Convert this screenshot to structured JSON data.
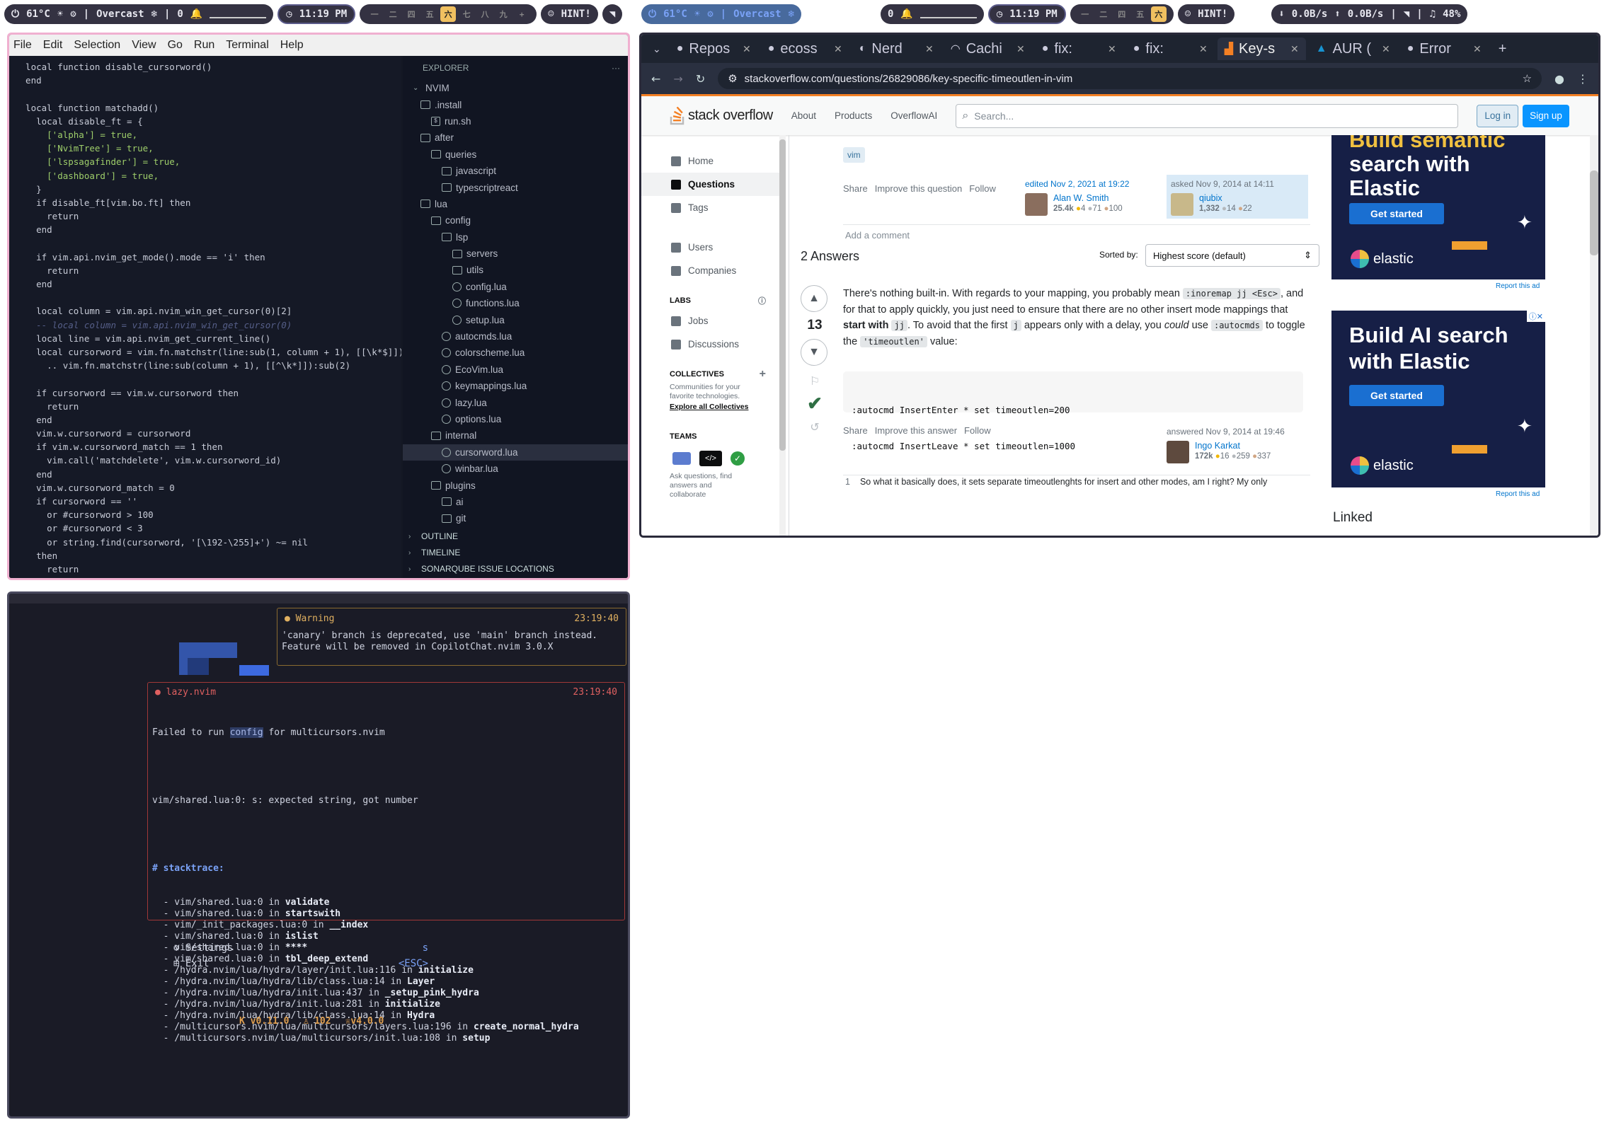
{
  "waybar_left": {
    "temp": "61°C",
    "weather": "Overcast",
    "notifications": "0",
    "clock": "11:19 PM",
    "hint": "HINT!"
  },
  "waybar_right": {
    "temp": "61°C",
    "weather": "Overcast",
    "notifications": "0",
    "clock": "11:19 PM",
    "hint": "HINT!",
    "net_down": "0.0B/s",
    "net_up": "0.0B/s",
    "battery": "48%"
  },
  "vscode": {
    "menu": [
      "File",
      "Edit",
      "Selection",
      "View",
      "Go",
      "Run",
      "Terminal",
      "Help"
    ],
    "explorer_title": "EXPLORER",
    "explorer_more": "···",
    "root": "NVIM",
    "tree": [
      {
        "label": ".install",
        "type": "folder",
        "depth": 1
      },
      {
        "label": "run.sh",
        "type": "shell",
        "depth": 2
      },
      {
        "label": "after",
        "type": "folder",
        "depth": 1
      },
      {
        "label": "queries",
        "type": "folder",
        "depth": 2
      },
      {
        "label": "javascript",
        "type": "folder",
        "depth": 3
      },
      {
        "label": "typescriptreact",
        "type": "folder",
        "depth": 3
      },
      {
        "label": "lua",
        "type": "folder",
        "depth": 1
      },
      {
        "label": "config",
        "type": "folder",
        "depth": 2
      },
      {
        "label": "lsp",
        "type": "folder",
        "depth": 3
      },
      {
        "label": "servers",
        "type": "folder",
        "depth": 4
      },
      {
        "label": "utils",
        "type": "folder",
        "depth": 4
      },
      {
        "label": "config.lua",
        "type": "lua",
        "depth": 4
      },
      {
        "label": "functions.lua",
        "type": "lua",
        "depth": 4
      },
      {
        "label": "setup.lua",
        "type": "lua",
        "depth": 4
      },
      {
        "label": "autocmds.lua",
        "type": "lua",
        "depth": 3
      },
      {
        "label": "colorscheme.lua",
        "type": "lua",
        "depth": 3
      },
      {
        "label": "EcoVim.lua",
        "type": "lua",
        "depth": 3
      },
      {
        "label": "keymappings.lua",
        "type": "lua",
        "depth": 3
      },
      {
        "label": "lazy.lua",
        "type": "lua",
        "depth": 3
      },
      {
        "label": "options.lua",
        "type": "lua",
        "depth": 3
      },
      {
        "label": "internal",
        "type": "folder",
        "depth": 2
      },
      {
        "label": "cursorword.lua",
        "type": "lua",
        "depth": 3,
        "selected": true
      },
      {
        "label": "winbar.lua",
        "type": "lua",
        "depth": 3
      },
      {
        "label": "plugins",
        "type": "folder",
        "depth": 2
      },
      {
        "label": "ai",
        "type": "folder",
        "depth": 3
      },
      {
        "label": "git",
        "type": "folder",
        "depth": 3
      }
    ],
    "sections": [
      "OUTLINE",
      "TIMELINE",
      "SONARQUBE ISSUE LOCATIONS"
    ]
  },
  "code_lines": [
    "  local function disable_cursorword()",
    "  end",
    "",
    "  local function matchadd()",
    "    local disable_ft = {",
    "      ['alpha'] = true,",
    "      ['NvimTree'] = true,",
    "      ['lspsagafinder'] = true,",
    "      ['dashboard'] = true,",
    "    }",
    "    if disable_ft[vim.bo.ft] then",
    "      return",
    "    end",
    "",
    "    if vim.api.nvim_get_mode().mode == 'i' then",
    "      return",
    "    end",
    "",
    "    local column = vim.api.nvim_win_get_cursor(0)[2]",
    "    -- local column = vim.api.nvim_win_get_cursor(0)",
    "    local line = vim.api.nvim_get_current_line()",
    "    local cursorword = vim.fn.matchstr(line:sub(1, column + 1), [[\\k*$]])",
    "      .. vim.fn.matchstr(line:sub(column + 1), [[^\\k*]]):sub(2)",
    "",
    "    if cursorword == vim.w.cursorword then",
    "      return",
    "    end",
    "    vim.w.cursorword = cursorword",
    "    if vim.w.cursorword_match == 1 then",
    "      vim.call('matchdelete', vim.w.cursorword_id)",
    "    end",
    "    vim.w.cursorword_match = 0",
    "    if cursorword == ''",
    "      or #cursorword > 100",
    "      or #cursorword < 3",
    "      or string.find(cursorword, '[\\192-\\255]+') ~= nil",
    "    then",
    "      return"
  ],
  "terminal": {
    "warning": {
      "title": "Warning",
      "time": "23:19:40",
      "lines": [
        "'canary' branch is deprecated, use 'main' branch instead.",
        "Feature will be removed in CopilotChat.nvim 3.0.X"
      ]
    },
    "error": {
      "title": "lazy.nvim",
      "time": "23:19:40",
      "line1_pre": "Failed to run ",
      "line1_hl": "config",
      "line1_post": " for multicursors.nvim",
      "line2": "vim/shared.lua:0: s: expected string, got number",
      "stack_title": "# stacktrace:",
      "stack": [
        {
          "loc": "  - vim/shared.lua:0 in ",
          "fn": "validate"
        },
        {
          "loc": "  - vim/shared.lua:0 in ",
          "fn": "startswith"
        },
        {
          "loc": "  - vim/_init_packages.lua:0 in ",
          "fn": "__index"
        },
        {
          "loc": "  - vim/shared.lua:0 in ",
          "fn": "islist"
        },
        {
          "loc": "  - vim/shared.lua:0 in ",
          "fn": "****"
        },
        {
          "loc": "  - vim/shared.lua:0 in ",
          "fn": "tbl_deep_extend"
        },
        {
          "loc": "  - /hydra.nvim/lua/hydra/layer/init.lua:116 in ",
          "fn": "initialize"
        },
        {
          "loc": "  - /hydra.nvim/lua/hydra/lib/class.lua:14 in ",
          "fn": "Layer"
        },
        {
          "loc": "  - /hydra.nvim/lua/hydra/init.lua:437 in ",
          "fn": "_setup_pink_hydra"
        },
        {
          "loc": "  - /hydra.nvim/lua/hydra/init.lua:281 in ",
          "fn": "initialize"
        },
        {
          "loc": "  - /hydra.nvim/lua/hydra/lib/class.lua:14 in ",
          "fn": "Hydra"
        },
        {
          "loc": "  - /multicursors.nvim/lua/multicursors/layers.lua:196 in ",
          "fn": "create_normal_hydra"
        },
        {
          "loc": "  - /multicursors.nvim/lua/multicursors/init.lua:108 in ",
          "fn": "setup"
        }
      ]
    },
    "menu": [
      {
        "label": "Settings",
        "key": "s",
        "icon": "⚙"
      },
      {
        "label": "Exit",
        "key": "<ESC>",
        "icon": "⊞"
      }
    ],
    "stats": {
      "version": "v0.11.0",
      "plugins": "102",
      "lazy_version": "v4.0.0"
    }
  },
  "browser": {
    "tabs": [
      {
        "label": "Repos",
        "icon": "github"
      },
      {
        "label": "ecoss",
        "icon": "github"
      },
      {
        "label": "Nerd",
        "icon": "nerd"
      },
      {
        "label": "Cachi",
        "icon": "cache"
      },
      {
        "label": "fix: ",
        "icon": "github"
      },
      {
        "label": "fix: ",
        "icon": "github"
      },
      {
        "label": "Key-s",
        "icon": "so",
        "active": true
      },
      {
        "label": "AUR (",
        "icon": "arch"
      },
      {
        "label": "Error",
        "icon": "github"
      }
    ],
    "url": "stackoverflow.com/questions/26829086/key-specific-timeoutlen-in-vim"
  },
  "so": {
    "logo": "stack overflow",
    "nav_links": [
      "About",
      "Products",
      "OverflowAI"
    ],
    "search_placeholder": "Search...",
    "login": "Log in",
    "signup": "Sign up",
    "sidebar": [
      "Home",
      "Questions",
      "Tags",
      "Users",
      "Companies"
    ],
    "labs_title": "LABS",
    "labs": [
      "Jobs",
      "Discussions"
    ],
    "collectives_title": "COLLECTIVES",
    "collectives_text": "Communities for your favorite technologies.",
    "collectives_link": "Explore all Collectives",
    "teams_title": "TEAMS",
    "teams_text": "Ask questions, find answers and collaborate",
    "tag": "vim",
    "q_actions": [
      "Share",
      "Improve this question",
      "Follow"
    ],
    "edited": {
      "label": "edited Nov 2, 2021 at 19:22",
      "user": "Alan W. Smith",
      "rep": "25.4k",
      "gold": "4",
      "silver": "71",
      "bronze": "100"
    },
    "asked": {
      "label": "asked Nov 9, 2014 at 14:11",
      "user": "qiubix",
      "rep": "1,332",
      "silver": "14",
      "bronze": "22"
    },
    "add_comment": "Add a comment",
    "answers_count": "2 Answers",
    "sorted_by": "Sorted by:",
    "sort_option": "Highest score (default)",
    "answer": {
      "score": "13",
      "p1": "There's nothing built-in. With regards to your mapping, you probably mean",
      "code1": ":inoremap jj <Esc>",
      "p2": ", and for that to apply quickly, you just need to ensure that there are no other insert mode mappings that",
      "strong": "start with",
      "code2": "jj",
      "p3": ". To avoid that the first",
      "code3": "j",
      "p4": "appears only with a delay, you",
      "em": "could",
      "p5": "use",
      "code4": ":autocmds",
      "p6": "to toggle the",
      "code5": "'timeoutlen'",
      "p7": "value:",
      "pre": [
        ":autocmd InsertEnter * set timeoutlen=200",
        ":autocmd InsertLeave * set timeoutlen=1000"
      ],
      "actions": [
        "Share",
        "Improve this answer",
        "Follow"
      ],
      "answered": "answered Nov 9, 2014 at 19:46",
      "user": "Ingo Karkat",
      "rep": "172k",
      "gold": "16",
      "silver": "259",
      "bronze": "337",
      "comment_num": "1",
      "comment": "So what it basically does, it sets separate timeoutlenghts for insert and other modes, am I right? My only"
    },
    "ad1": {
      "title_line1": "Build semantic",
      "title_line2": "search with",
      "title_line3": "Elastic",
      "button": "Get started",
      "brand": "elastic",
      "report": "Report this ad"
    },
    "ad2": {
      "title_line1": "Build AI search",
      "title_line2": "with Elastic",
      "button": "Get started",
      "brand": "elastic",
      "report": "Report this ad"
    },
    "linked": "Linked"
  }
}
